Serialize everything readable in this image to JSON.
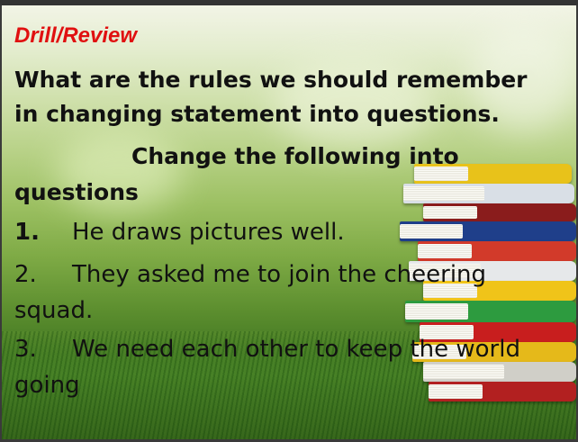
{
  "slide": {
    "heading": "Drill/Review",
    "question": "What are the rules we should remember in changing statement into questions.",
    "instruction_line1": "Change the following into",
    "instruction_line2": "questions",
    "items": [
      {
        "number": "1.",
        "line1": "He draws pictures well.",
        "line2": ""
      },
      {
        "number": "2.",
        "line1": "They asked me to join the cheering",
        "line2": "squad."
      },
      {
        "number": "3.",
        "line1": "We need each other to keep the world",
        "line2": "going"
      }
    ]
  },
  "colors": {
    "heading": "#e01010",
    "text": "#111111"
  }
}
